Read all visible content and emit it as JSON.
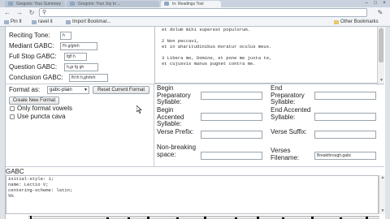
{
  "browser": {
    "tabs": [
      {
        "label": "Gregorio: Your Summary"
      },
      {
        "label": "Gregorio: Your Joy to ..."
      },
      {
        "label": "In: Readings Tool"
      }
    ],
    "window_buttons": [
      "–",
      "□",
      "×"
    ],
    "nav": {
      "back": "←",
      "forward": "→",
      "reload": "↻"
    },
    "address_value": "",
    "menu_icon": "wrench-icon",
    "bookmarks": [
      {
        "label": "Pin It"
      },
      {
        "label": "ravel it"
      },
      {
        "label": "Import Bookmar..."
      }
    ],
    "other_bookmarks": "Other Bookmarks"
  },
  "form": {
    "fields": [
      {
        "label": "Reciting Tone:",
        "value": "h"
      },
      {
        "label": "Mediant GABC:",
        "value": "f'h g/ghrh"
      },
      {
        "label": "Full Stop GABC:",
        "value": "fgfl h"
      },
      {
        "label": "Question GABC:",
        "value": "h,gr fg gh"
      },
      {
        "label": "Conclusion GABC:",
        "value": "fh'rh h,ghrhrh"
      }
    ],
    "format_label": "Format as:",
    "format_value": "gabc-plain",
    "reset_button": "Reset Current Format",
    "new_format_button": "Create New Format",
    "only_format_vowels": "Only format vowels",
    "use_puncta_cava": "Use puncta cava"
  },
  "text_lines": [
    "et dolum mihi superest populorum.",
    "",
    "2 Non peccavi,",
    "et in aharitudinibus moratur oculus meus.",
    "",
    "3 Libera me, Domine, et pone me juxta te,",
    "et cujusvis manus pugnet contra me."
  ],
  "syllable_settings": {
    "begin_preparatory": "Begin Preparatory Syllable:",
    "end_preparatory": "End Preparatory Syllable:",
    "begin_accented": "Begin Accented Syllable:",
    "end_accented": "End Accented Syllable:",
    "verse_prefix": "Verse Prefix:",
    "verse_suffix": "Verse Suffix:",
    "non_breaking_space": "Non-breaking space:",
    "verses_filename": "Verses Filename:",
    "verses_filename_value": "Breakthrough.gabc"
  },
  "gabc": {
    "heading": "GABC",
    "lines": [
      "initial-style: 1;",
      "name: Lectio V;",
      "centering-scheme: latin;",
      "%%"
    ]
  }
}
